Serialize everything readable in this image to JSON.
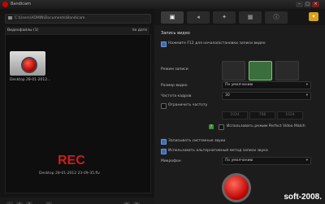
{
  "window": {
    "title": "Bandicam"
  },
  "path": {
    "value": "C:\\Users\\ADMIN\\Documents\\Bandicam"
  },
  "list": {
    "header_left": "Видеофайлы (1)",
    "header_right": "по дате"
  },
  "file": {
    "label": "Desktop 28-01-2012..."
  },
  "recording": {
    "status": "REC",
    "file": "Desktop 28-01-2012 23-09-35.flv"
  },
  "settings": {
    "section_title": "Запись видео",
    "hotkey_label": "Нажмите F12 для начала/остановки записи видео",
    "mode_label": "Режим записи",
    "size_label": "Размер видео",
    "size_value": "По умолчанию",
    "fps_label": "Частота кадров",
    "fps_value": "30",
    "limit_label": "Ограничить частоту",
    "limit_fields": [
      "1024",
      "768",
      "1024"
    ],
    "perfect_label": "Использовать режим Perfect Video Match",
    "system_sound_label": "Записывать системные звуки",
    "mix_label": "Использовать альтернативный метод записи звука",
    "mic_label": "Микрофон",
    "mic_value": "По умолчанию"
  },
  "watermark": "soft-2008."
}
